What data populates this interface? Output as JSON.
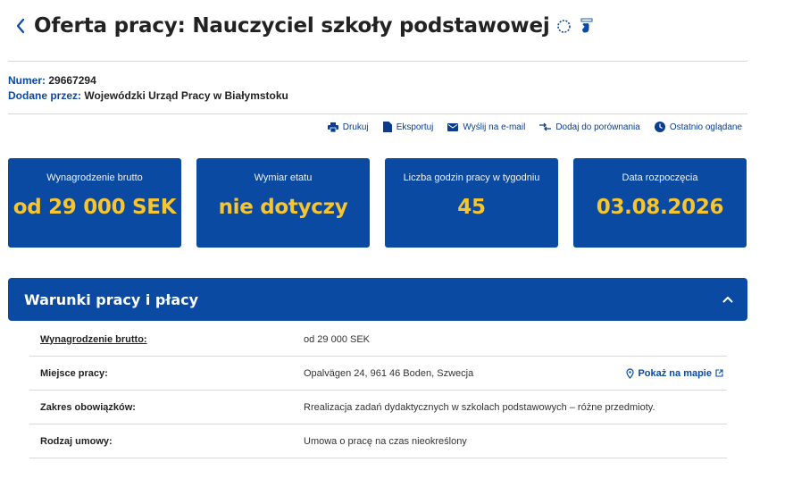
{
  "header": {
    "title": "Oferta pracy: Nauczyciel szkoły podstawowej"
  },
  "meta": {
    "number_label": "Numer:",
    "number_value": "29667294",
    "added_label": "Dodane przez:",
    "added_value": "Wojewódzki Urząd Pracy w Białymstoku"
  },
  "actions": [
    {
      "label": "Drukuj",
      "icon": "printer-icon"
    },
    {
      "label": "Eksportuj",
      "icon": "document-icon"
    },
    {
      "label": "Wyślij na e-mail",
      "icon": "mail-icon"
    },
    {
      "label": "Dodaj do porównania",
      "icon": "compare-icon"
    },
    {
      "label": "Ostatnio oglądane",
      "icon": "clock-icon"
    }
  ],
  "cards": [
    {
      "label": "Wynagrodzenie brutto",
      "value": "od 29 000 SEK"
    },
    {
      "label": "Wymiar etatu",
      "value": "nie dotyczy"
    },
    {
      "label": "Liczba godzin pracy w tygodniu",
      "value": "45"
    },
    {
      "label": "Data rozpoczęcia",
      "value": "03.08.2026"
    }
  ],
  "section": {
    "title": "Warunki pracy i płacy",
    "rows": [
      {
        "key": "Wynagrodzenie brutto:",
        "value": "od 29 000 SEK"
      },
      {
        "key": "Miejsce pracy:",
        "value": "Opalvägen 24, 961 46  Boden, Szwecja",
        "link": "Pokaż na mapie"
      },
      {
        "key": "Zakres obowiązków:",
        "value": "Rrealizacja zadań dydaktycznych w szkolach podstawowych – różne przedmioty."
      },
      {
        "key": "Rodzaj umowy:",
        "value": "Umowa o pracę na czas nieokreślony"
      }
    ]
  },
  "colors": {
    "primary": "#0a4aa3",
    "accent": "#f7c530"
  }
}
